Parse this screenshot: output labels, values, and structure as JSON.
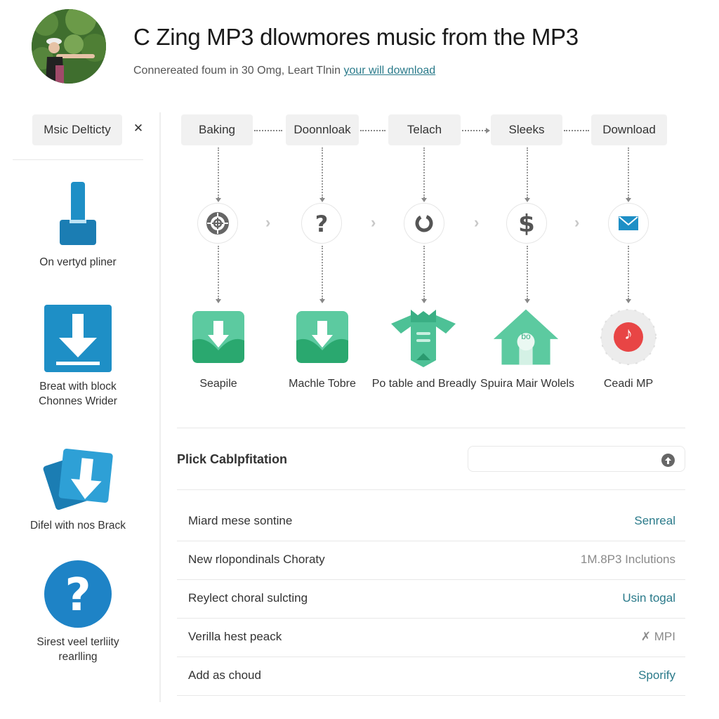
{
  "header": {
    "title": "C Zing MP3 dlowmores music from the MP3",
    "subtitle_text": "Connereated foum in 30 Omg, Leart Tlnin ",
    "subtitle_link": "your will download"
  },
  "sidebar": {
    "tab_label": "Msic Delticty",
    "close_glyph": "✕",
    "items": [
      {
        "label": "On vertyd pliner",
        "icon": "pin-icon"
      },
      {
        "label": "Breat with block Chonnes Wrider",
        "icon": "download-box-icon"
      },
      {
        "label": "Difel with nos Brack",
        "icon": "download-stack-icon"
      },
      {
        "label": "Sirest veel terliity rearlling",
        "icon": "help-circle-icon"
      }
    ]
  },
  "flow": {
    "steps": [
      {
        "label": "Baking",
        "circle_icon": "target-icon"
      },
      {
        "label": "Doonnloak",
        "circle_icon": "question-icon"
      },
      {
        "label": "Telach",
        "circle_icon": "loading-ring-icon"
      },
      {
        "label": "Sleeks",
        "circle_icon": "dollar-icon"
      },
      {
        "label": "Download",
        "circle_icon": "mail-icon"
      }
    ],
    "chevron_glyph": "›",
    "apps": [
      {
        "label": "Seapile",
        "icon": "green-download-app-icon"
      },
      {
        "label": "Machle Tobre",
        "icon": "green-download-app-icon"
      },
      {
        "label": "Po table and Breadly",
        "icon": "green-banner-app-icon"
      },
      {
        "label": "Spuira Mair Wolels",
        "icon": "green-house-app-icon",
        "badge": "bo"
      },
      {
        "label": "Ceadi MP",
        "icon": "red-music-note-icon",
        "glyph": "♪"
      }
    ]
  },
  "section": {
    "title": "Plick Cablpfitation",
    "search_value": "",
    "search_placeholder": ""
  },
  "rows": [
    {
      "name": "Miard mese sontine",
      "value": "Senreal",
      "value_color": "#2a7a8a"
    },
    {
      "name": "New rlopondinals Choraty",
      "value": "1M.8P3 Inclutions",
      "value_color": "#8a8a8a"
    },
    {
      "name": "Reylect choral sulcting",
      "value": "Usin togal",
      "value_color": "#2a7a8a"
    },
    {
      "name": "Verilla hest peack",
      "value": "✗ MPI",
      "value_color": "#8a8a8a"
    },
    {
      "name": "Add as choud",
      "value": "Sporify",
      "value_color": "#2a7a8a"
    }
  ],
  "colors": {
    "accent_blue": "#1e8fc6",
    "accent_green": "#3dbf8f",
    "accent_red": "#e84545",
    "link_teal": "#2a7a8a"
  }
}
